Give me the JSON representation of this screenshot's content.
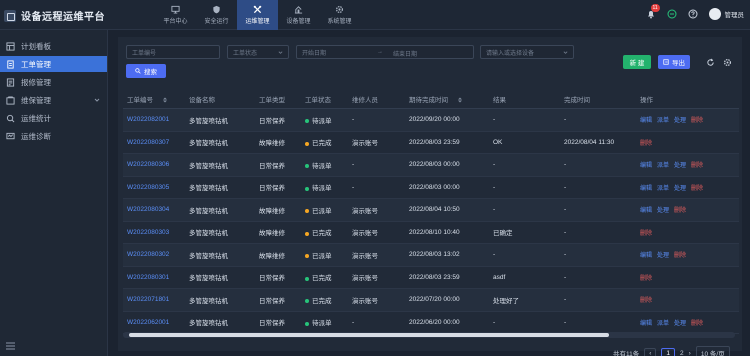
{
  "app": {
    "title": "设备远程运维平台"
  },
  "nav": [
    {
      "label": "平台中心",
      "icon": "monitor-icon",
      "active": false
    },
    {
      "label": "安全运行",
      "icon": "shield-icon",
      "active": false
    },
    {
      "label": "运维管理",
      "icon": "tools-icon",
      "active": true
    },
    {
      "label": "设备管理",
      "icon": "equipment-icon",
      "active": false
    },
    {
      "label": "系统管理",
      "icon": "gear-icon",
      "active": false
    }
  ],
  "header": {
    "notification_count": "11",
    "user_name": "管理员"
  },
  "sidebar": {
    "items": [
      {
        "label": "计划看板",
        "icon": "board-icon"
      },
      {
        "label": "工单管理",
        "icon": "document-icon",
        "active": true
      },
      {
        "label": "报修管理",
        "icon": "report-icon"
      },
      {
        "label": "维保管理",
        "icon": "maintenance-icon",
        "expandable": true
      },
      {
        "label": "运维统计",
        "icon": "stats-icon"
      },
      {
        "label": "运维诊断",
        "icon": "diagnosis-icon"
      }
    ]
  },
  "filters": {
    "order_no_placeholder": "工单编号",
    "status_placeholder": "工单状态",
    "start_date_placeholder": "开始日期",
    "date_separator": "→",
    "end_date_placeholder": "结束日期",
    "device_placeholder": "请输入或选择设备",
    "search_label": "搜索"
  },
  "toolbar": {
    "new_label": "新 建",
    "export_label": "导出"
  },
  "table": {
    "headers": [
      "工单编号",
      "设备名称",
      "工单类型",
      "工单状态",
      "维修人员",
      "期待完成时间",
      "结果",
      "完成时间",
      "操作"
    ],
    "rows": [
      {
        "id": "W2022082001",
        "device": "多管旋喷钻机",
        "type": "日常保养",
        "status": "待派单",
        "status_color": "#27c47a",
        "person": "-",
        "expected": "2022/09/20 00:00",
        "result": "-",
        "done": "-",
        "ops": [
          "编辑",
          "派单",
          "处理",
          "删除"
        ]
      },
      {
        "id": "W2022080307",
        "device": "多管旋喷钻机",
        "type": "故障维修",
        "status": "已完成",
        "status_color": "#f5a623",
        "person": "演示账号",
        "expected": "2022/08/03 23:59",
        "result": "OK",
        "done": "2022/08/04 11:30",
        "ops": [
          "删除"
        ]
      },
      {
        "id": "W2022080306",
        "device": "多管旋喷钻机",
        "type": "日常保养",
        "status": "待派单",
        "status_color": "#27c47a",
        "person": "-",
        "expected": "2022/08/03 00:00",
        "result": "-",
        "done": "-",
        "ops": [
          "编辑",
          "派单",
          "处理",
          "删除"
        ]
      },
      {
        "id": "W2022080305",
        "device": "多管旋喷钻机",
        "type": "日常保养",
        "status": "待派单",
        "status_color": "#27c47a",
        "person": "-",
        "expected": "2022/08/03 00:00",
        "result": "-",
        "done": "-",
        "ops": [
          "编辑",
          "派单",
          "处理",
          "删除"
        ]
      },
      {
        "id": "W2022080304",
        "device": "多管旋喷钻机",
        "type": "故障维修",
        "status": "已派单",
        "status_color": "#f5a623",
        "person": "演示账号",
        "expected": "2022/08/04 10:50",
        "result": "-",
        "done": "-",
        "ops": [
          "编辑",
          "处理",
          "删除"
        ]
      },
      {
        "id": "W2022080303",
        "device": "多管旋喷钻机",
        "type": "故障维修",
        "status": "已完成",
        "status_color": "#f5a623",
        "person": "演示账号",
        "expected": "2022/08/10 10:40",
        "result": "已确定",
        "done": "-",
        "ops": [
          "删除"
        ]
      },
      {
        "id": "W2022080302",
        "device": "多管旋喷钻机",
        "type": "故障维修",
        "status": "已派单",
        "status_color": "#f5a623",
        "person": "演示账号",
        "expected": "2022/08/03 13:02",
        "result": "-",
        "done": "-",
        "ops": [
          "编辑",
          "处理",
          "删除"
        ]
      },
      {
        "id": "W2022080301",
        "device": "多管旋喷钻机",
        "type": "日常保养",
        "status": "已完成",
        "status_color": "#27c47a",
        "person": "演示账号",
        "expected": "2022/08/03 23:59",
        "result": "asdf",
        "done": "-",
        "ops": [
          "删除"
        ]
      },
      {
        "id": "W2022071801",
        "device": "多管旋喷钻机",
        "type": "日常保养",
        "status": "已完成",
        "status_color": "#27c47a",
        "person": "演示账号",
        "expected": "2022/07/20 00:00",
        "result": "处理好了",
        "done": "-",
        "ops": [
          "删除"
        ]
      },
      {
        "id": "W2022062001",
        "device": "多管旋喷钻机",
        "type": "日常保养",
        "status": "待派单",
        "status_color": "#27c47a",
        "person": "-",
        "expected": "2022/06/20 00:00",
        "result": "-",
        "done": "-",
        "ops": [
          "编辑",
          "派单",
          "处理",
          "删除"
        ]
      }
    ]
  },
  "pagination": {
    "total_text": "共有11条",
    "prev": "‹",
    "current_page": "1",
    "next_page": "2",
    "next": "›",
    "page_size": "10 条/页"
  },
  "colors": {
    "accent": "#4d6cf2",
    "success": "#23b26d",
    "danger": "#e35d5d",
    "link": "#5b8ff9"
  }
}
